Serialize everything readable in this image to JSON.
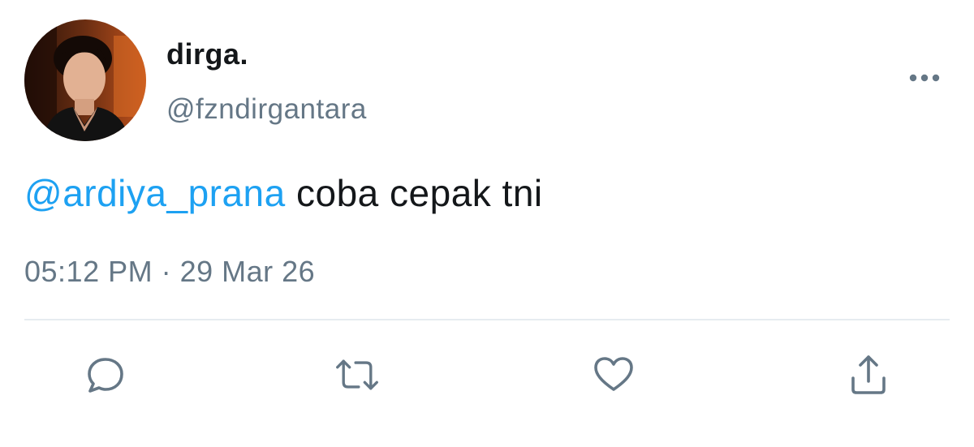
{
  "tweet": {
    "display_name": "dirga.",
    "handle": "@fzndirgantara",
    "mention": "@ardiya_prana",
    "text": " coba cepak tni",
    "time": "05:12 PM",
    "separator": " · ",
    "date": "29 Mar 26"
  },
  "icons": {
    "more": "more-horizontal-icon",
    "reply": "reply-icon",
    "retweet": "retweet-icon",
    "like": "heart-icon",
    "share": "share-icon"
  },
  "colors": {
    "text": "#14171a",
    "secondary": "#657786",
    "link": "#1da1f2",
    "divider": "#e6ecf0"
  }
}
